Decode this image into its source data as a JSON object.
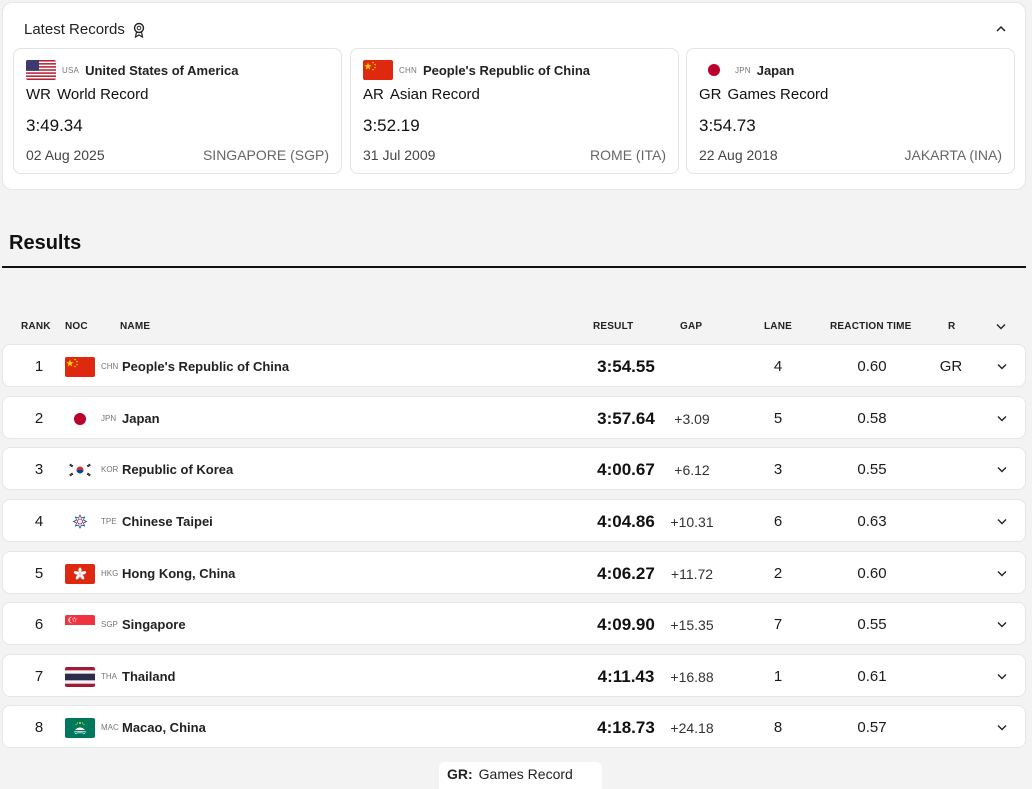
{
  "latest_records": {
    "title": "Latest Records",
    "records": [
      {
        "noc": "USA",
        "country": "United States of America",
        "type_abbr": "WR",
        "type_name": "World Record",
        "time": "3:49.34",
        "date": "02 Aug 2025",
        "place": "SINGAPORE (SGP)"
      },
      {
        "noc": "CHN",
        "country": "People's Republic of China",
        "type_abbr": "AR",
        "type_name": "Asian Record",
        "time": "3:52.19",
        "date": "31 Jul 2009",
        "place": "ROME (ITA)"
      },
      {
        "noc": "JPN",
        "country": "Japan",
        "type_abbr": "GR",
        "type_name": "Games Record",
        "time": "3:54.73",
        "date": "22 Aug 2018",
        "place": "JAKARTA (INA)"
      }
    ]
  },
  "results": {
    "title": "Results",
    "columns": {
      "rank": "RANK",
      "noc": "NOC",
      "name": "NAME",
      "result": "RESULT",
      "gap": "GAP",
      "lane": "LANE",
      "reaction_time": "REACTION TIME",
      "r": "R"
    },
    "rows": [
      {
        "rank": "1",
        "noc": "CHN",
        "name": "People's Republic of China",
        "result": "3:54.55",
        "gap": "",
        "lane": "4",
        "reaction_time": "0.60",
        "r": "GR"
      },
      {
        "rank": "2",
        "noc": "JPN",
        "name": "Japan",
        "result": "3:57.64",
        "gap": "+3.09",
        "lane": "5",
        "reaction_time": "0.58",
        "r": ""
      },
      {
        "rank": "3",
        "noc": "KOR",
        "name": "Republic of Korea",
        "result": "4:00.67",
        "gap": "+6.12",
        "lane": "3",
        "reaction_time": "0.55",
        "r": ""
      },
      {
        "rank": "4",
        "noc": "TPE",
        "name": "Chinese Taipei",
        "result": "4:04.86",
        "gap": "+10.31",
        "lane": "6",
        "reaction_time": "0.63",
        "r": ""
      },
      {
        "rank": "5",
        "noc": "HKG",
        "name": "Hong Kong, China",
        "result": "4:06.27",
        "gap": "+11.72",
        "lane": "2",
        "reaction_time": "0.60",
        "r": ""
      },
      {
        "rank": "6",
        "noc": "SGP",
        "name": "Singapore",
        "result": "4:09.90",
        "gap": "+15.35",
        "lane": "7",
        "reaction_time": "0.55",
        "r": ""
      },
      {
        "rank": "7",
        "noc": "THA",
        "name": "Thailand",
        "result": "4:11.43",
        "gap": "+16.88",
        "lane": "1",
        "reaction_time": "0.61",
        "r": ""
      },
      {
        "rank": "8",
        "noc": "MAC",
        "name": "Macao, China",
        "result": "4:18.73",
        "gap": "+24.18",
        "lane": "8",
        "reaction_time": "0.57",
        "r": ""
      }
    ]
  },
  "legend": {
    "abbr": "GR:",
    "text": "Games Record"
  },
  "colors": {
    "china_red": "#de2910",
    "japan_red": "#bc002d",
    "usa_blue": "#3c3b6e",
    "macao_green": "#00785e"
  }
}
